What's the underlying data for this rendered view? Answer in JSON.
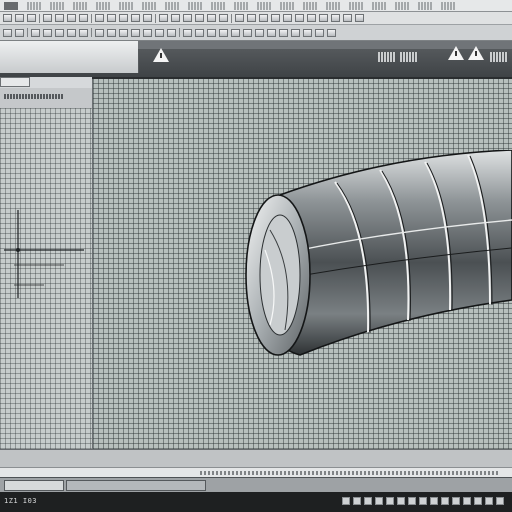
{
  "statusbar": {
    "coordinates_text": "1Z1 I03"
  },
  "ribbon": {
    "warning_icon_name": "warning-triangle-icon"
  },
  "viewport": {
    "background_color": "#b7bfbd",
    "grid_color": "#282e30",
    "model_object": "cylinder-3d-model"
  },
  "colors": {
    "ribbon_dark": "#3f4346",
    "status_dark": "#1e2021"
  }
}
